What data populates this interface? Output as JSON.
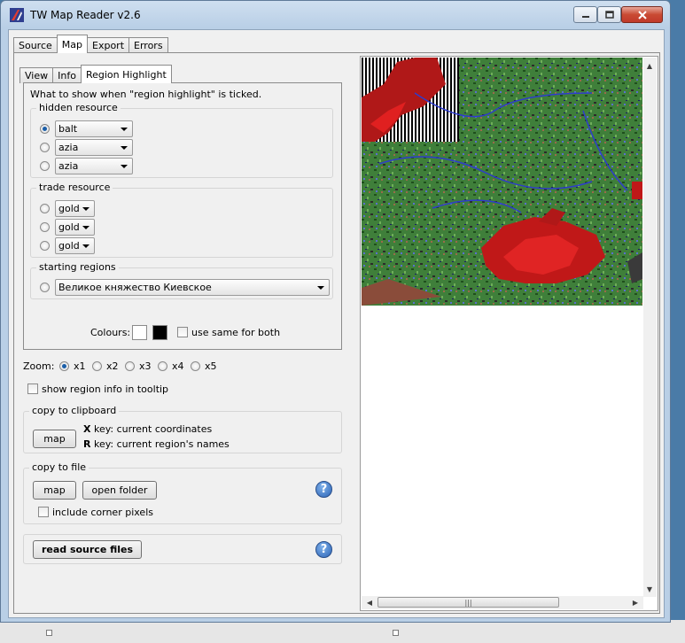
{
  "window": {
    "title": "TW Map Reader v2.6"
  },
  "main_tabs": [
    "Source",
    "Map",
    "Export",
    "Errors"
  ],
  "sub_tabs": [
    "View",
    "Info",
    "Region Highlight"
  ],
  "region_highlight": {
    "description": "What to show when \"region highlight\" is ticked.",
    "hidden_resource": {
      "label": "hidden resource",
      "options": [
        "balt",
        "azia",
        "azia"
      ]
    },
    "trade_resource": {
      "label": "trade resource",
      "options": [
        "gold",
        "gold",
        "gold"
      ]
    },
    "starting_regions": {
      "label": "starting regions",
      "value": "Великое княжество Киевское"
    },
    "colours": {
      "label": "Colours:",
      "colour_a": "#ffffff",
      "colour_b": "#000000",
      "same_label": "use same for both"
    }
  },
  "zoom": {
    "label": "Zoom:",
    "options": [
      "x1",
      "x2",
      "x3",
      "x4",
      "x5"
    ],
    "selected": "x1"
  },
  "tooltip_check": "show region info in tooltip",
  "clipboard": {
    "label": "copy to clipboard",
    "map_button": "map",
    "hint1_key": "X",
    "hint1_text": " key: current coordinates",
    "hint2_key": "R",
    "hint2_text": " key: current region's names"
  },
  "file": {
    "label": "copy to file",
    "map_button": "map",
    "open_folder_button": "open folder",
    "corner_check": "include corner pixels"
  },
  "read_source_button": "read source files",
  "icons": {
    "help": "?",
    "app": "tw-map-reader-icon"
  },
  "scroll": {
    "thumb_grip": "|||"
  }
}
